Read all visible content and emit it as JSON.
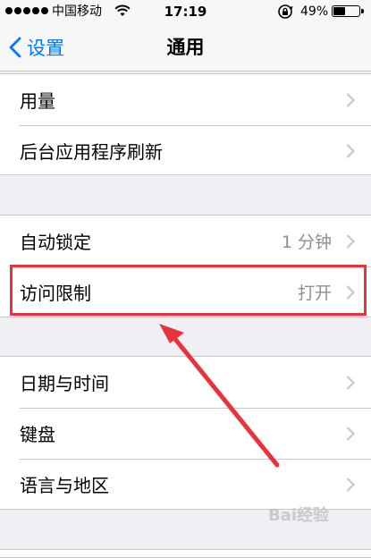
{
  "status_bar": {
    "carrier": "中国移动",
    "time": "17:19",
    "battery_percent": "49%",
    "battery_level": 0.49,
    "icons": [
      "signal-dots-icon",
      "wifi-icon",
      "rotation-lock-icon",
      "battery-icon"
    ]
  },
  "nav": {
    "back_label": "设置",
    "title": "通用"
  },
  "groups": [
    {
      "rows": [
        {
          "label": "用量",
          "value": ""
        },
        {
          "label": "后台应用程序刷新",
          "value": ""
        }
      ]
    },
    {
      "rows": [
        {
          "label": "自动锁定",
          "value": "1 分钟"
        },
        {
          "label": "访问限制",
          "value": "打开"
        }
      ]
    },
    {
      "rows": [
        {
          "label": "日期与时间",
          "value": ""
        },
        {
          "label": "键盘",
          "value": ""
        },
        {
          "label": "语言与地区",
          "value": ""
        }
      ]
    }
  ],
  "annotations": {
    "highlight_color": "#e8333c",
    "highlighted_row": "访问限制"
  },
  "watermark": {
    "text": "Bai经验"
  },
  "colors": {
    "accent": "#007aff",
    "background": "#efeff4",
    "secondary_text": "#8e8e93"
  }
}
